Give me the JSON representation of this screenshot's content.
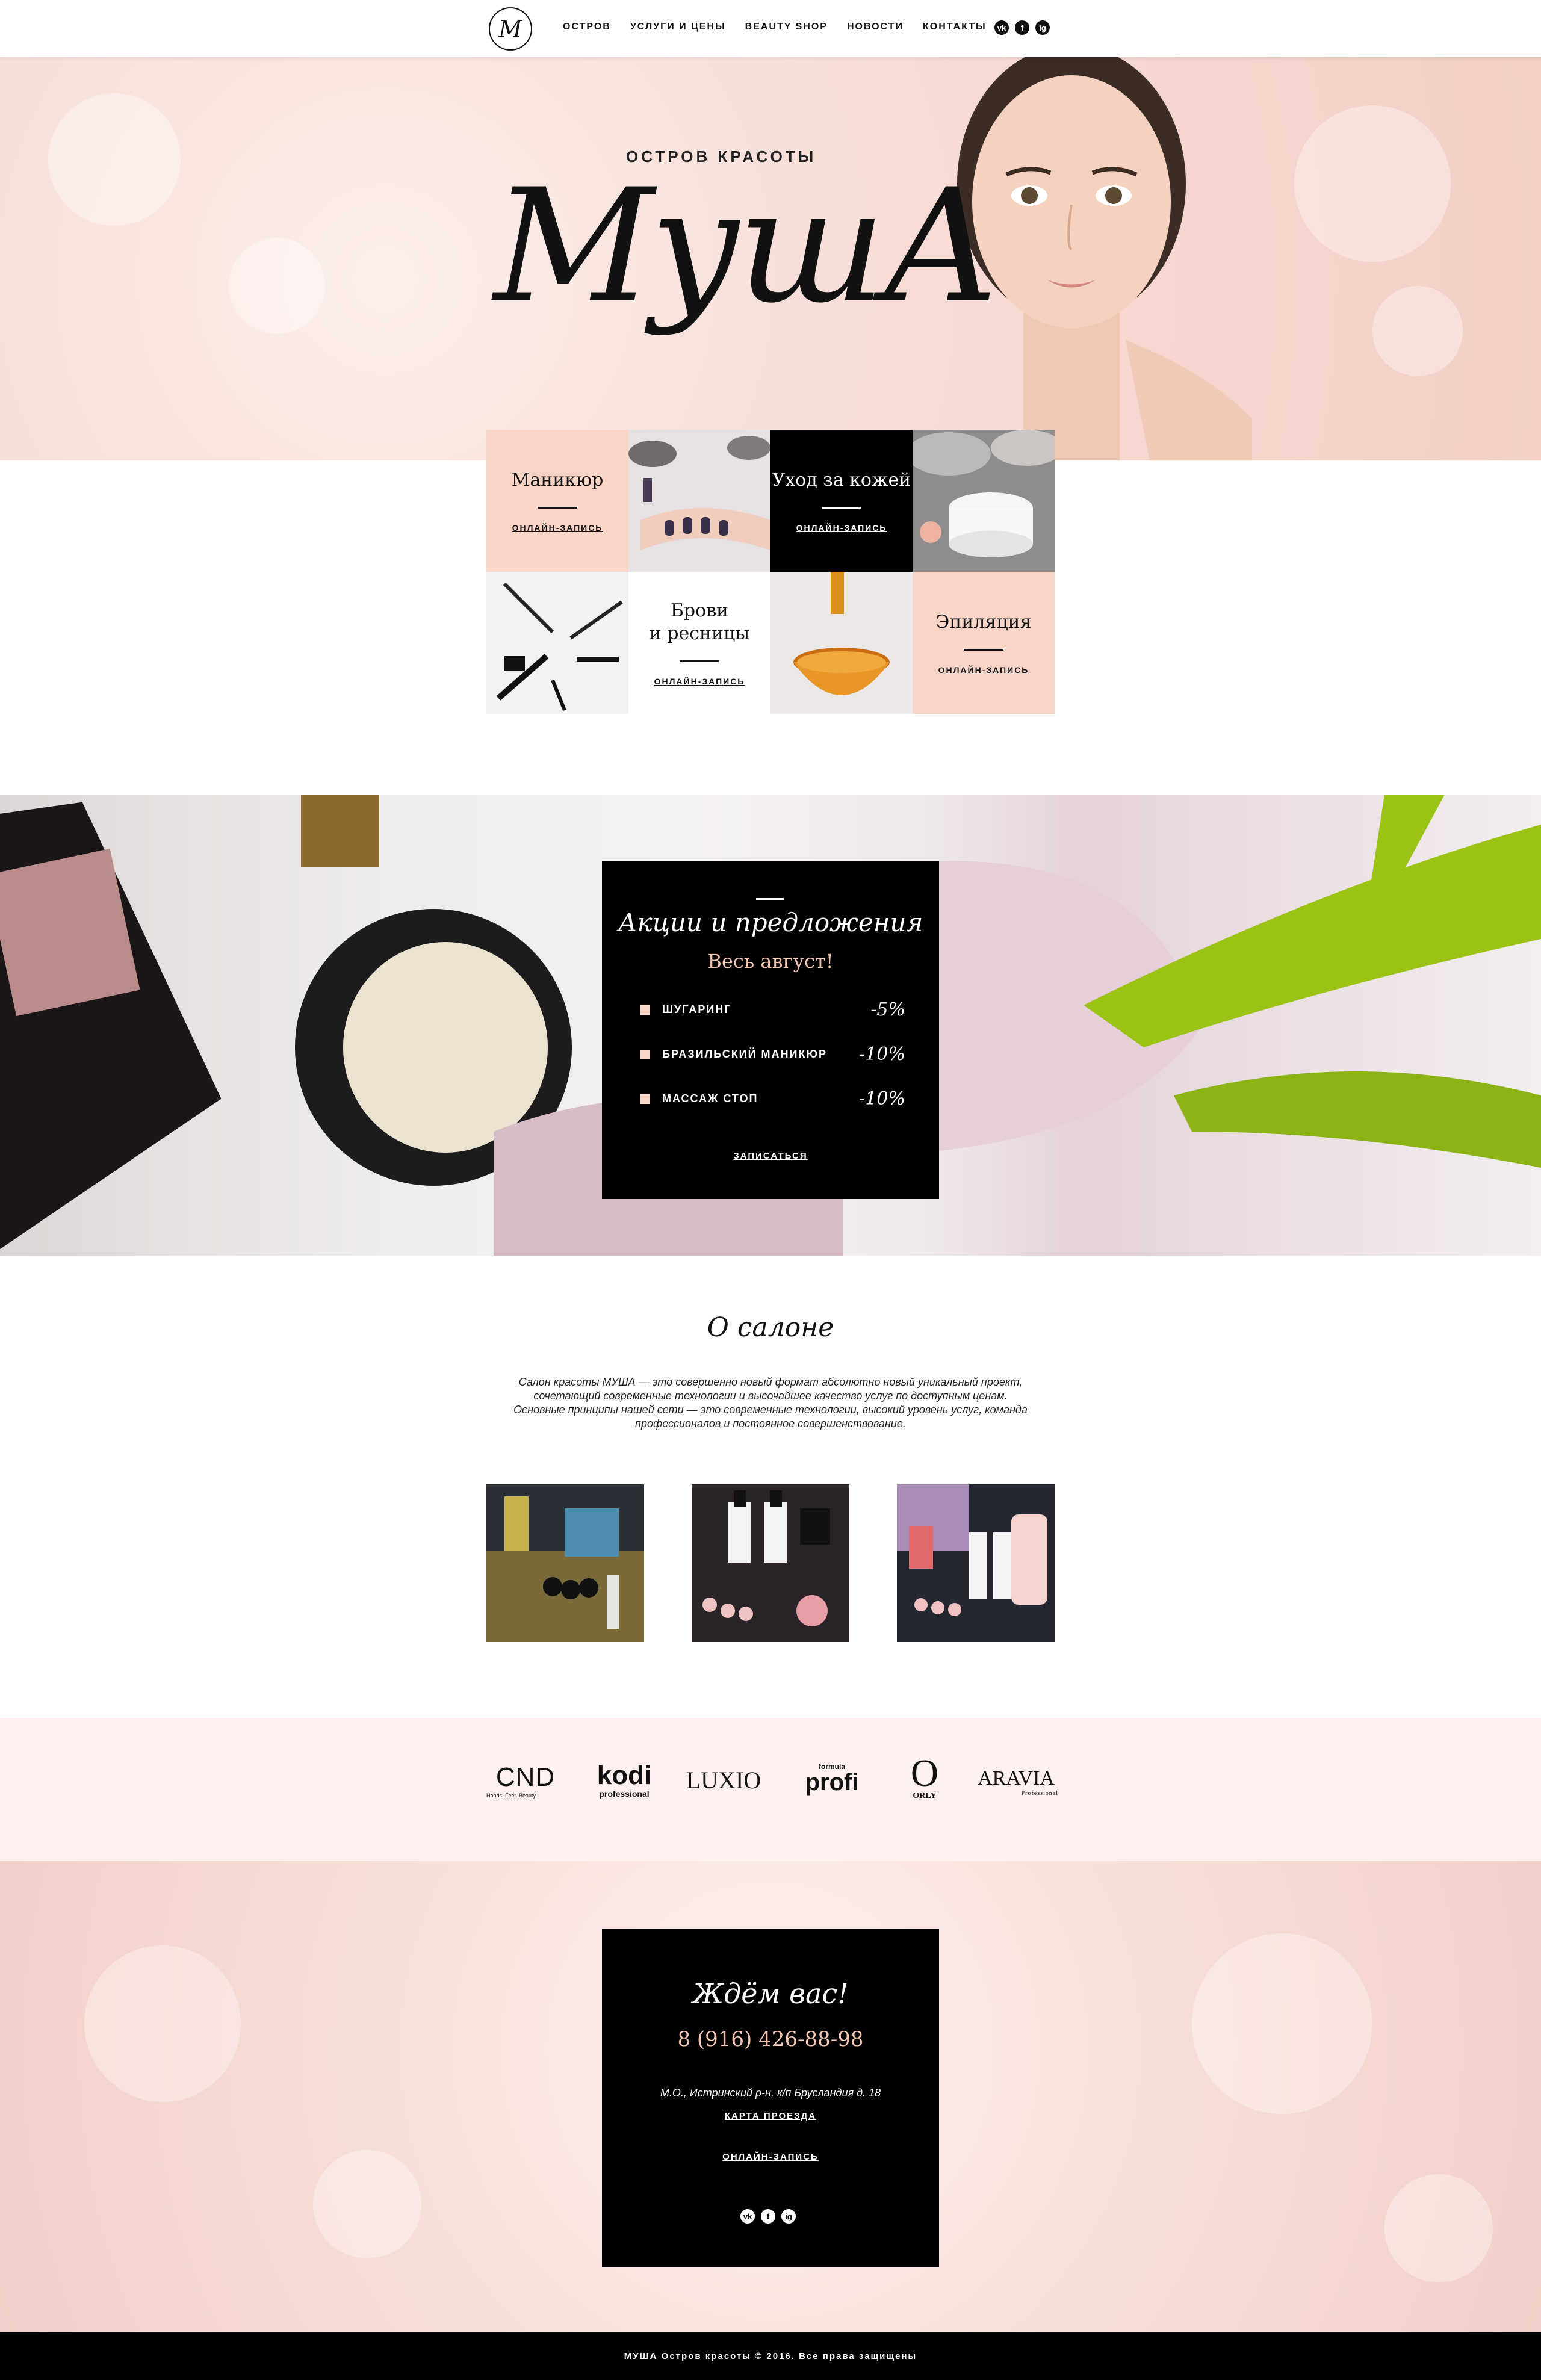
{
  "nav": {
    "logo_letter": "М",
    "items": [
      "ОСТРОВ",
      "УСЛУГИ И ЦЕНЫ",
      "BEAUTY SHOP",
      "НОВОСТИ",
      "КОНТАКТЫ"
    ],
    "social": [
      "vk",
      "f",
      "ig"
    ]
  },
  "hero": {
    "tagline": "ОСТРОВ КРАСОТЫ",
    "script": "МушА"
  },
  "services": {
    "manicure": {
      "title": "Маникюр",
      "cta": "ОНЛАЙН-ЗАПИСЬ"
    },
    "skincare": {
      "title": "Уход за кожей",
      "cta": "ОНЛАЙН-ЗАПИСЬ"
    },
    "brows": {
      "title_line1": "Брови",
      "title_line2": "и ресницы",
      "cta": "ОНЛАЙН-ЗАПИСЬ"
    },
    "epilation": {
      "title": "Эпиляция",
      "cta": "ОНЛАЙН-ЗАПИСЬ"
    }
  },
  "promo": {
    "title": "Акции и предложения",
    "subtitle": "Весь август!",
    "items": [
      {
        "label": "ШУГАРИНГ",
        "discount": "-5%"
      },
      {
        "label": "БРАЗИЛЬСКИЙ МАНИКЮР",
        "discount": "-10%"
      },
      {
        "label": "МАССАЖ СТОП",
        "discount": "-10%"
      }
    ],
    "cta": "ЗАПИСАТЬСЯ"
  },
  "about": {
    "title": "О салоне",
    "lines": [
      "Салон красоты МУША — это совершенно новый формат абсолютно новый уникальный  проект,",
      "сочетающий современные технологии и высочайшее качество услуг по доступным ценам.",
      "Основные принципы нашей сети — это современные технологии, высокий уровень услуг, команда",
      "профессионалов и постоянное совершенствование."
    ]
  },
  "brands": [
    {
      "name": "CND",
      "sub": "Hands. Feet. Beauty."
    },
    {
      "name": "kodi",
      "sub": "professional"
    },
    {
      "name": "LUXIO",
      "sub": ""
    },
    {
      "name": "profi",
      "sub": "formula"
    },
    {
      "name": "O",
      "sub": "ORLY"
    },
    {
      "name": "ARAVIA",
      "sub": "Professional"
    }
  ],
  "contact": {
    "title": "Ждём вас!",
    "phone": "8 (916) 426-88-98",
    "address": "М.О., Истринский р-н, к/п Брусландия д. 18",
    "map_link": "КАРТА ПРОЕЗДА",
    "booking_link": "ОНЛАЙН-ЗАПИСЬ"
  },
  "footer": {
    "text": "МУША Остров красоты © 2016. Все права защищены"
  },
  "colors": {
    "accent_pink": "#f9d5c8",
    "accent_text_pink": "#f5c7b5",
    "dark": "#000000"
  }
}
